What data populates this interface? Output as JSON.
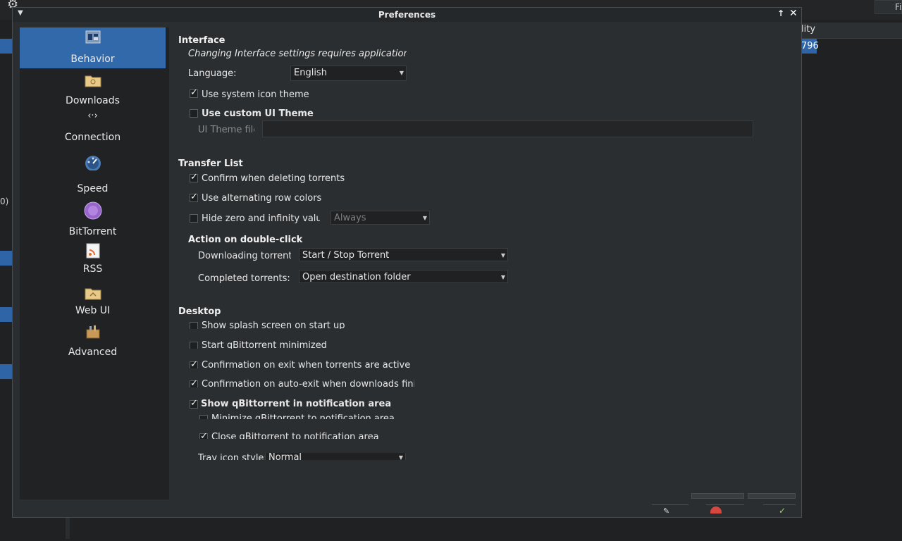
{
  "background": {
    "top_right_button": "Fi",
    "table_header": "lity",
    "table_value": "796",
    "left_clip_text": "0)"
  },
  "window": {
    "title": "Preferences",
    "menu_icon": "chevron-down-icon",
    "maximize_icon": "arrow-up-icon",
    "close_icon": "close-icon"
  },
  "sidebar": {
    "items": [
      {
        "label": "Behavior",
        "icon": "behavior-icon"
      },
      {
        "label": "Downloads",
        "icon": "folder-icon"
      },
      {
        "label": "Connection",
        "icon": "connection-arrows-icon"
      },
      {
        "label": "Speed",
        "icon": "speedometer-icon"
      },
      {
        "label": "BitTorrent",
        "icon": "bittorrent-icon"
      },
      {
        "label": "RSS",
        "icon": "rss-icon"
      },
      {
        "label": "Web UI",
        "icon": "web-folder-icon"
      },
      {
        "label": "Advanced",
        "icon": "toolbox-icon"
      }
    ]
  },
  "interface": {
    "heading": "Interface",
    "note": "Changing Interface settings requires application resta",
    "language_label": "Language:",
    "language_value": "English",
    "use_system_icon_theme": "Use system icon theme",
    "use_custom_ui_theme": "Use custom UI Theme",
    "ui_theme_file_label": "UI Theme file"
  },
  "transfer_list": {
    "heading": "Transfer List",
    "confirm_delete": "Confirm when deleting torrents",
    "alternating_colors": "Use alternating row colors",
    "hide_zero": "Hide zero and infinity value:",
    "hide_zero_value": "Always",
    "action_heading": "Action on double-click",
    "downloading_label": "Downloading torrent:",
    "downloading_value": "Start / Stop Torrent",
    "completed_label": "Completed torrents:",
    "completed_value": "Open destination folder"
  },
  "desktop": {
    "heading": "Desktop",
    "splash": "Show splash screen on start up",
    "start_minimized": "Start qBittorrent minimized",
    "confirm_exit": "Confirmation on exit when torrents are active",
    "confirm_auto_exit": "Confirmation on auto-exit when downloads finish",
    "show_notification_area": "Show qBittorrent in notification area",
    "minimize_to_tray": "Minimize qBittorrent to notification area",
    "close_to_tray": "Close qBittorrent to notification area",
    "tray_icon_style_label": "Tray icon style:",
    "tray_icon_style_value": "Normal"
  },
  "footer": {
    "apply_icon": "apply-icon",
    "cancel_icon": "cancel-icon",
    "ok_icon": "ok-icon"
  }
}
